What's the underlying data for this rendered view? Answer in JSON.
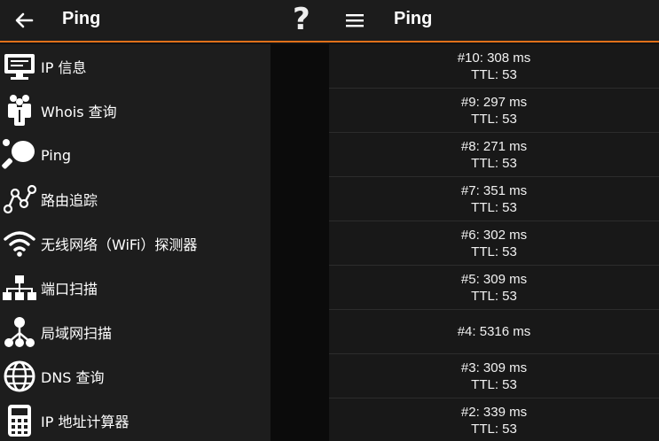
{
  "header": {
    "title_left": "Ping",
    "help_glyph": "?",
    "title_right": "Ping"
  },
  "drawer": {
    "items": [
      {
        "label": "IP 信息",
        "icon": "monitor-icon"
      },
      {
        "label": "Whois 查询",
        "icon": "people-icon"
      },
      {
        "label": "Ping",
        "icon": "ping-pong-icon"
      },
      {
        "label": "路由追踪",
        "icon": "route-icon"
      },
      {
        "label": "无线网络（WiFi）探测器",
        "icon": "wifi-icon"
      },
      {
        "label": "端口扫描",
        "icon": "network-icon"
      },
      {
        "label": "局域网扫描",
        "icon": "lan-icon"
      },
      {
        "label": "DNS 查询",
        "icon": "globe-icon"
      },
      {
        "label": "IP 地址计算器",
        "icon": "calculator-icon"
      }
    ]
  },
  "results": [
    {
      "line1": "#10: 308 ms",
      "line2": "TTL: 53"
    },
    {
      "line1": "#9: 297 ms",
      "line2": "TTL: 53"
    },
    {
      "line1": "#8: 271 ms",
      "line2": "TTL: 53"
    },
    {
      "line1": "#7: 351 ms",
      "line2": "TTL: 53"
    },
    {
      "line1": "#6: 302 ms",
      "line2": "TTL: 53"
    },
    {
      "line1": "#5: 309 ms",
      "line2": "TTL: 53"
    },
    {
      "line1": "#4: 5316 ms",
      "line2": ""
    },
    {
      "line1": "#3: 309 ms",
      "line2": "TTL: 53"
    },
    {
      "line1": "#2: 339 ms",
      "line2": "TTL: 53"
    }
  ]
}
